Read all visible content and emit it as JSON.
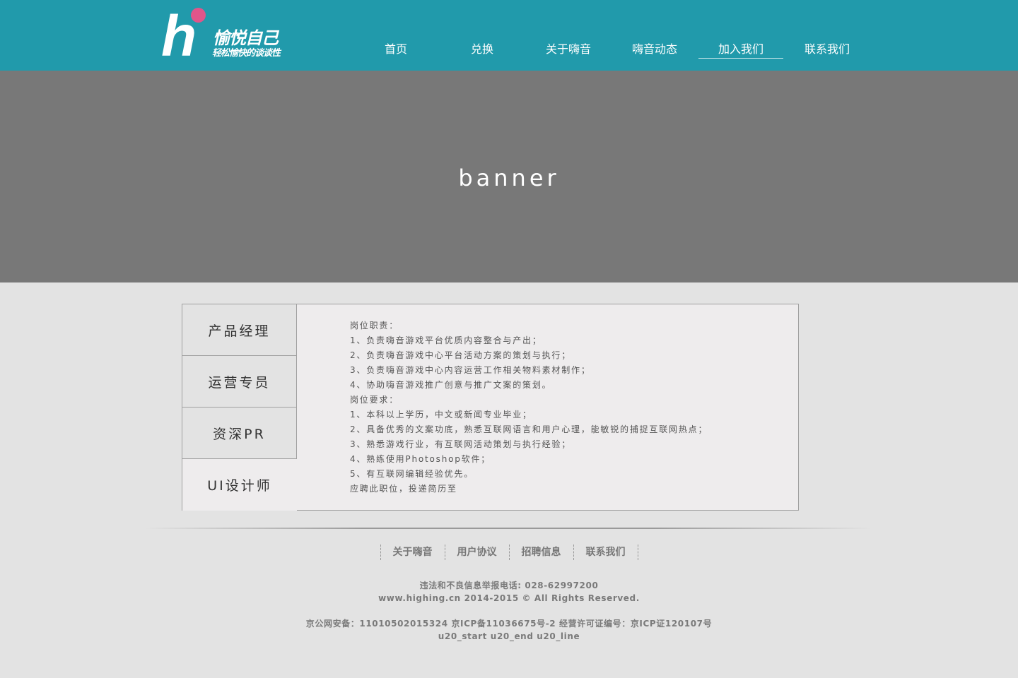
{
  "header": {
    "logo": {
      "letter": "h",
      "title": "愉悦自己",
      "slogan": "轻松愉快的谈谈性"
    },
    "nav": [
      {
        "label": "首页"
      },
      {
        "label": "兑换"
      },
      {
        "label": "关于嗨音"
      },
      {
        "label": "嗨音动态"
      },
      {
        "label": "加入我们",
        "active": true
      },
      {
        "label": "联系我们"
      }
    ]
  },
  "banner": {
    "text": "banner"
  },
  "jobs": {
    "tabs": [
      {
        "label": "产品经理"
      },
      {
        "label": "运营专员"
      },
      {
        "label": "资深PR"
      },
      {
        "label": "UI设计师",
        "active": true
      }
    ],
    "content": [
      "岗位职责：",
      "1、负责嗨音游戏平台优质内容整合与产出；",
      "2、负责嗨音游戏中心平台活动方案的策划与执行；",
      "3、负责嗨音游戏中心内容运营工作相关物料素材制作；",
      "4、协助嗨音游戏推广创意与推广文案的策划。",
      "岗位要求：",
      "1、本科以上学历，中文或新闻专业毕业；",
      "2、具备优秀的文案功底，熟悉互联网语言和用户心理，能敏锐的捕捉互联网热点；",
      "3、熟悉游戏行业，有互联网活动策划与执行经验；",
      "4、熟练使用Photoshop软件；",
      "5、有互联网编辑经验优先。",
      "应聘此职位，投递简历至"
    ]
  },
  "footer": {
    "links": [
      "关于嗨音",
      "用户协议",
      "招聘信息",
      "联系我们"
    ],
    "report": "违法和不良信息举报电话: 028-62997200",
    "copyright": "www.highing.cn 2014-2015 © All Rights Reserved.",
    "icp": "京公网安备：11010502015324 京ICP备11036675号-2 经营许可证编号：京ICP证120107号",
    "debug": "u20_start u20_end u20_line"
  },
  "colors": {
    "header_bg": "#219aab",
    "logo_dot": "#e0558a",
    "banner_bg": "#787878",
    "page_bg": "#e3e3e3"
  }
}
